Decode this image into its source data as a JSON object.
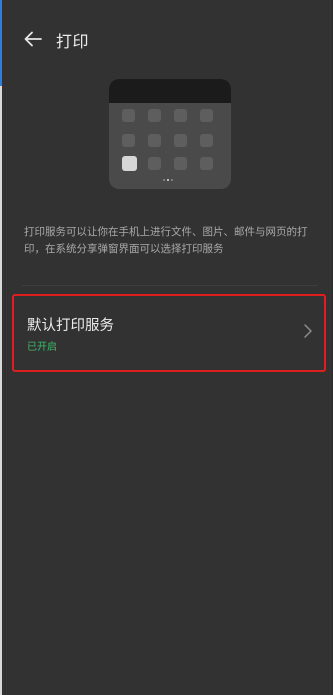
{
  "header": {
    "title": "打印",
    "back_icon": "arrow-left-icon"
  },
  "illustration": {
    "icon": "phone-app-grid-illustration"
  },
  "description": "打印服务可以让你在手机上进行文件、图片、邮件与网页的打印，在系统分享弹窗界面可以选择打印服务",
  "settings": {
    "default_print_service": {
      "label": "默认打印服务",
      "status": "已开启",
      "status_color": "#3fb86a",
      "chevron_icon": "chevron-right-icon"
    }
  },
  "colors": {
    "background": "#323232",
    "highlight_border": "#e01e1e"
  }
}
